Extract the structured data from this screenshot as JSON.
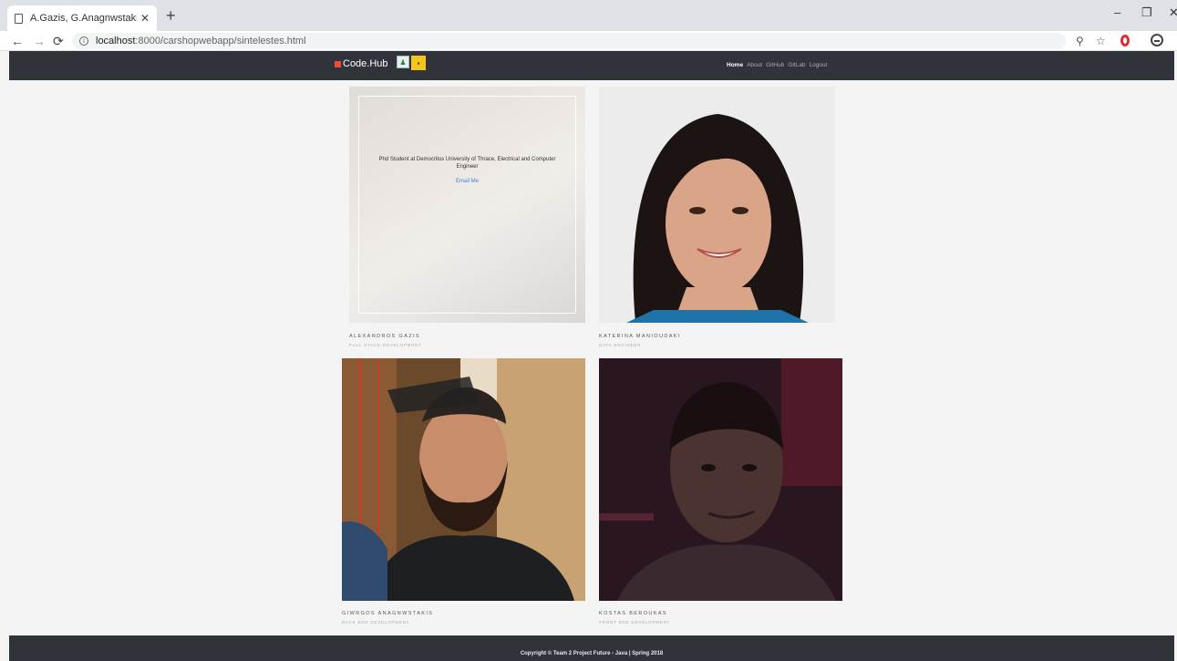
{
  "browser": {
    "tab_title": "A.Gazis, G.Anagnwstakis,K.Berouk",
    "url_host": "localhost",
    "url_path": ":8000/carshopwebapp/sintelestes.html"
  },
  "nav": {
    "brand": "Code.Hub",
    "links": [
      {
        "label": "Home",
        "active": true
      },
      {
        "label": "About",
        "active": false
      },
      {
        "label": "GitHub",
        "active": false
      },
      {
        "label": "GitLab",
        "active": false
      },
      {
        "label": "Logout",
        "active": false
      }
    ]
  },
  "team": [
    {
      "name": "ALEXANDROS GAZIS",
      "role": "FULL STACK DEVELOPMENT",
      "bio": "Phd Student at Democritus University of Thrace, Electrical and Computer Engineer",
      "email_label": "Email Me"
    },
    {
      "name": "KATERINA MANIOUDAKI",
      "role": "DATA ENGINEER"
    },
    {
      "name": "GIWRGOS ANAGNWSTAKIS",
      "role": "BACK END DEVELOPMENT"
    },
    {
      "name": "KOSTAS BEROUKAS",
      "role": "FRONT END DEVELOPMENT"
    }
  ],
  "footer": {
    "copyright": "Copyright © Team 2 Project Future - Java | Spring 2018"
  }
}
